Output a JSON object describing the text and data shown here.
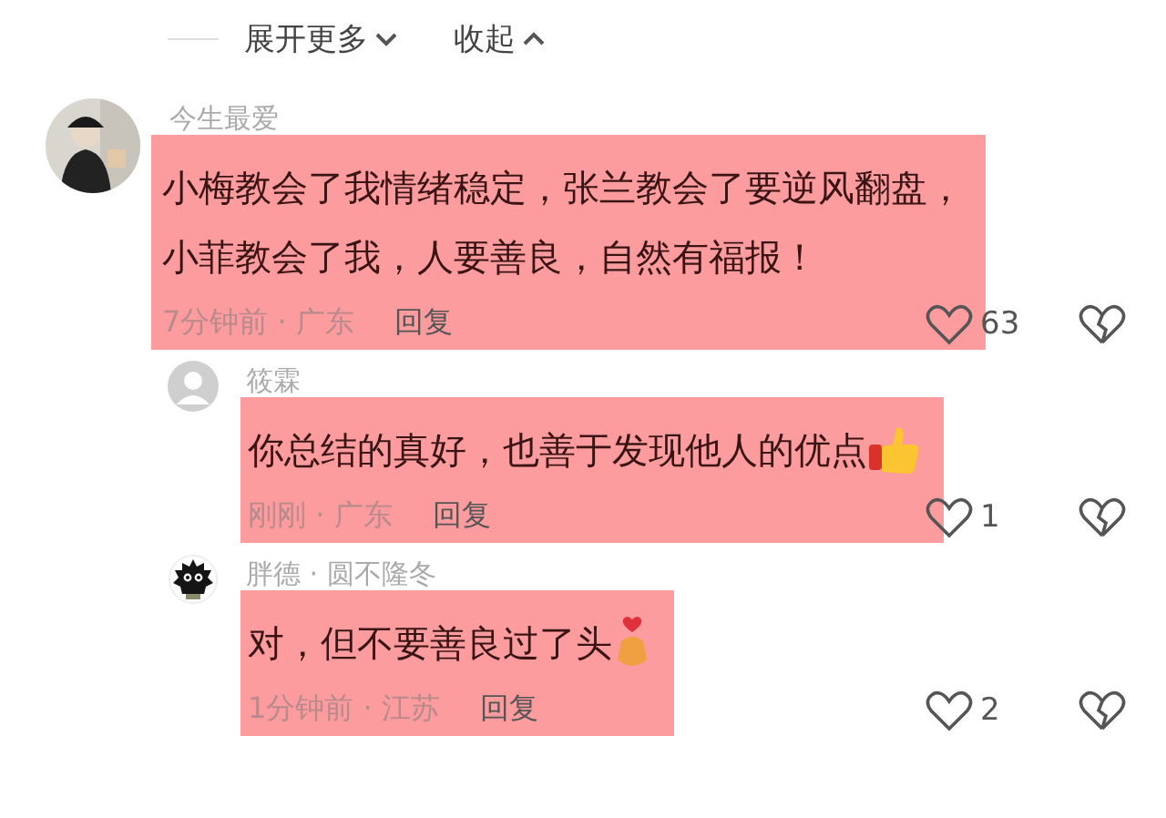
{
  "header": {
    "expand": "展开更多",
    "collapse": "收起"
  },
  "comments": [
    {
      "author": "今生最爱",
      "lines": [
        "小梅教会了我情绪稳定，张兰教会了要逆风翻盘，",
        "小菲教会了我，人要善良，自然有福报！"
      ],
      "time": "7分钟前 · 广东",
      "reply": "回复",
      "likes": "63",
      "children": [
        {
          "avatar": {
            "kind": "default"
          },
          "author": "筱霖",
          "lines": [
            "你总结的真好，也善于发现他人的优点"
          ],
          "emoji": {
            "kind": "thumbs"
          },
          "time": "刚刚 · 广东",
          "reply": "回复",
          "likes": "1"
        },
        {
          "avatar": {
            "kind": "sprite"
          },
          "author": "胖德 · 圆不隆冬",
          "lines": [
            "对，但不要善良过了头"
          ],
          "emoji": {
            "kind": "hearthands"
          },
          "time": "1分钟前 · 江苏",
          "reply": "回复",
          "likes": "2"
        }
      ]
    }
  ]
}
